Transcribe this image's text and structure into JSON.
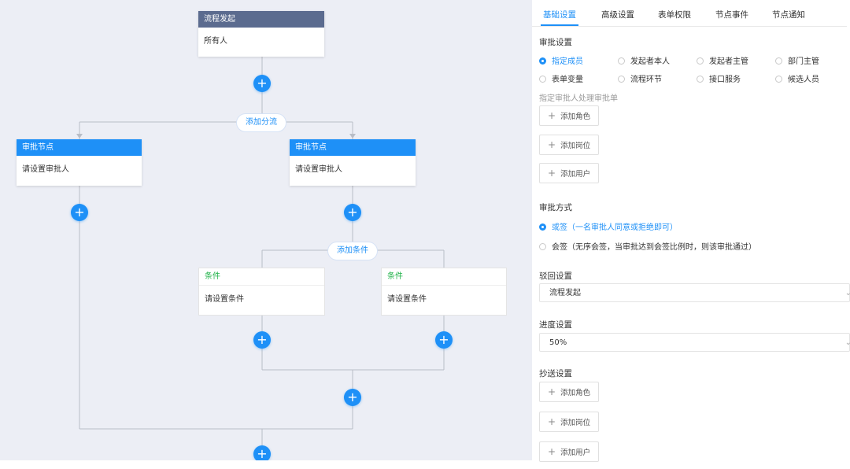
{
  "canvas": {
    "start_node": {
      "title": "流程发起",
      "body": "所有人"
    },
    "add_branch_label": "添加分流",
    "approver_left": {
      "title": "审批节点",
      "body": "请设置审批人"
    },
    "approver_right": {
      "title": "审批节点",
      "body": "请设置审批人"
    },
    "add_condition_label": "添加条件",
    "condition_left": {
      "title": "条件",
      "body": "请设置条件"
    },
    "condition_right": {
      "title": "条件",
      "body": "请设置条件"
    },
    "plus_glyph": "+",
    "colors": {
      "start_header": "#5b6b8f",
      "approver_header": "#1e90f7",
      "condition_title": "#22b34a",
      "add_button": "#1e90f7"
    }
  },
  "panel": {
    "tabs": [
      {
        "label": "基础设置",
        "active": true
      },
      {
        "label": "高级设置"
      },
      {
        "label": "表单权限"
      },
      {
        "label": "节点事件"
      },
      {
        "label": "节点通知"
      }
    ],
    "approval_settings": {
      "heading": "审批设置",
      "options": [
        {
          "label": "指定成员",
          "selected": true
        },
        {
          "label": "发起者本人"
        },
        {
          "label": "发起者主管"
        },
        {
          "label": "部门主管"
        },
        {
          "label": "表单变量"
        },
        {
          "label": "流程环节"
        },
        {
          "label": "接口服务"
        },
        {
          "label": "候选人员"
        }
      ],
      "hint": "指定审批人处理审批单",
      "buttons": [
        "添加角色",
        "添加岗位",
        "添加用户"
      ]
    },
    "approval_method": {
      "heading": "审批方式",
      "options": [
        {
          "label": "或签（一名审批人同意或拒绝即可）",
          "selected": true
        },
        {
          "label": "会签（无序会签，当审批达到会签比例时，则该审批通过）"
        }
      ]
    },
    "reject_settings": {
      "heading": "驳回设置",
      "value": "流程发起"
    },
    "progress_settings": {
      "heading": "进度设置",
      "value": "50%"
    },
    "cc_settings": {
      "heading": "抄送设置",
      "buttons": [
        "添加角色",
        "添加岗位",
        "添加用户"
      ]
    },
    "plus_glyph": "+",
    "accent": "#1e90f7"
  }
}
